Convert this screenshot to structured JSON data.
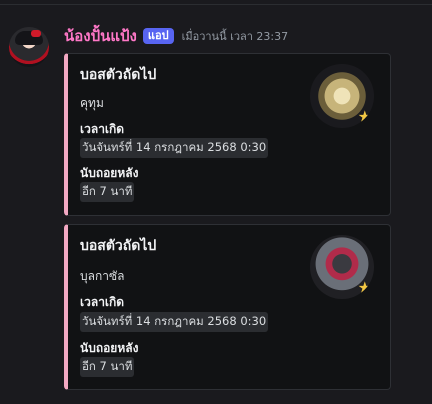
{
  "message": {
    "username": "น้องปั้นแป้ง",
    "badge": "แอป",
    "timestamp": "เมื่อวานนี้ เวลา 23:37"
  },
  "embeds": [
    {
      "title": "บอสตัวถัดไป",
      "description": "คุทุม",
      "fields": [
        {
          "name": "เวลาเกิด",
          "value": "วันจันทร์ที่ 14 กรกฎาคม 2568 0:30"
        },
        {
          "name": "นับถอยหลัง",
          "value": "อีก 7 นาที"
        }
      ],
      "thumbnail_icon": "boss-thumbnail-icon"
    },
    {
      "title": "บอสตัวถัดไป",
      "description": "บุลกาซัล",
      "fields": [
        {
          "name": "เวลาเกิด",
          "value": "วันจันทร์ที่ 14 กรกฎาคม 2568 0:30"
        },
        {
          "name": "นับถอยหลัง",
          "value": "อีก 7 นาที"
        }
      ],
      "thumbnail_icon": "boss-thumbnail-icon"
    }
  ],
  "colors": {
    "username": "#ff78c8",
    "badge": "#5865f2",
    "embed_accent": "#f2a8c2"
  }
}
